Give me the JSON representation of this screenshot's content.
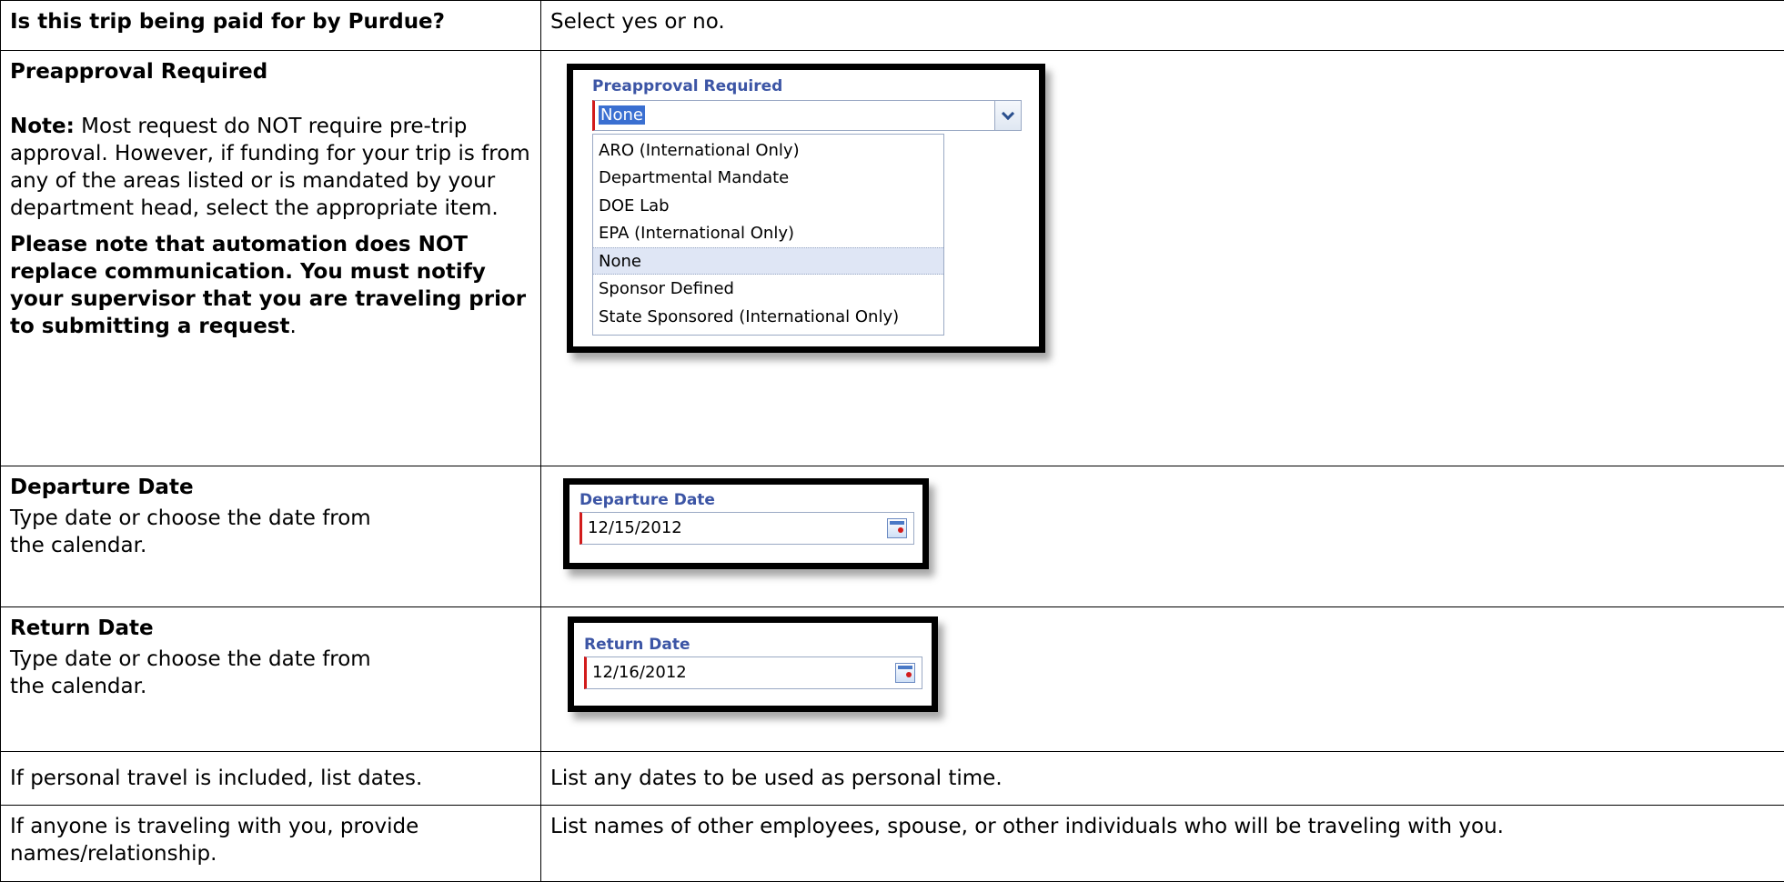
{
  "rows": {
    "paid_by_purdue": {
      "left": "Is this trip being paid for by Purdue?",
      "right": "Select yes or no."
    },
    "preapproval": {
      "title": "Preapproval Required",
      "note_label": "Note:",
      "note_text": " Most request do NOT require pre-trip approval. However, if funding for your trip is from any of the areas listed or is mandated by your department head, select the appropriate item.",
      "notice_text": "Please note that automation does NOT replace communication. You must notify your supervisor that you are traveling prior to submitting a request",
      "notice_tail": ".",
      "screenshot": {
        "label": "Preapproval Required",
        "selected_value": "None",
        "options": [
          "ARO (International Only)",
          "Departmental Mandate",
          "DOE Lab",
          "EPA (International Only)",
          "None",
          "Sponsor Defined",
          "State Sponsored (International Only)"
        ],
        "highlighted_option_index": 4
      }
    },
    "departure": {
      "title": "Departure Date",
      "text": "Type date or choose the date from the calendar.",
      "screenshot": {
        "label": "Departure Date",
        "value": "12/15/2012"
      }
    },
    "return": {
      "title": "Return Date",
      "text": "Type date or choose the date from the calendar.",
      "screenshot": {
        "label": "Return Date",
        "value": "12/16/2012"
      }
    },
    "personal_travel": {
      "left": "If personal travel is included, list dates.",
      "right": "List any dates to be used as personal time."
    },
    "companions": {
      "left": "If anyone is traveling with you, provide names/relationship.",
      "right": "List names of other employees, spouse, or other individuals who will be traveling with you."
    }
  },
  "icons": {
    "dropdown": "chevron-down-icon",
    "calendar": "calendar-icon"
  },
  "colors": {
    "label_blue": "#3c55a5",
    "required_red": "#d21b1b",
    "selection_blue": "#3a6fd1",
    "option_highlight": "#dfe6f5"
  }
}
